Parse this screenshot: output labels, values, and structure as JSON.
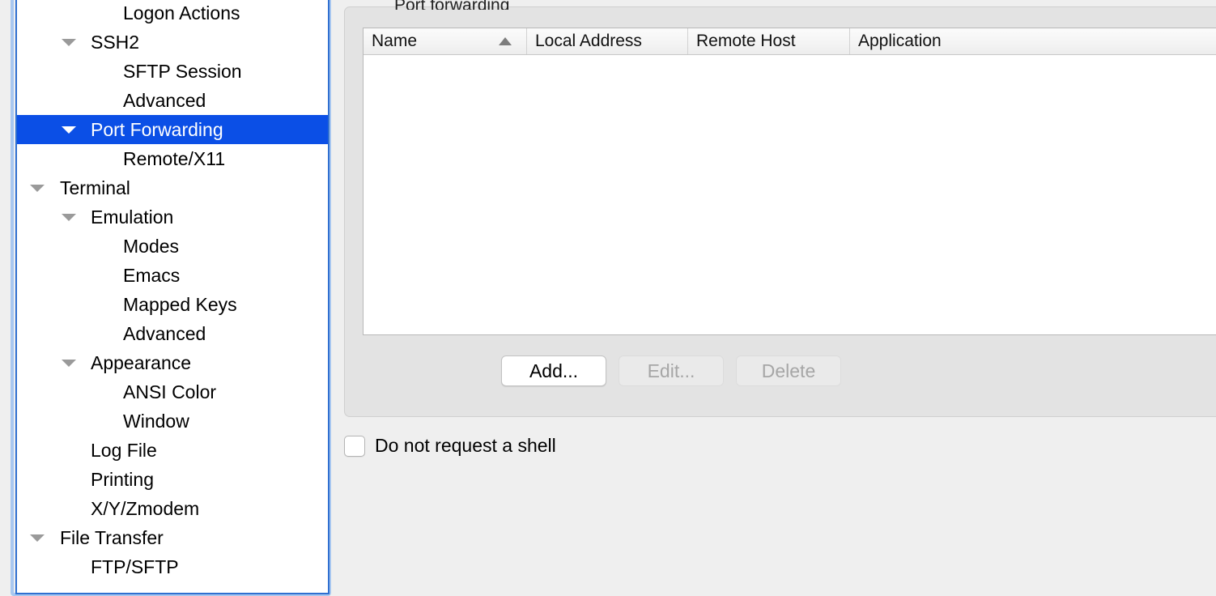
{
  "sidebar": {
    "name": "session-options-category-tree",
    "items": [
      {
        "label": "Logon Actions",
        "level": 3,
        "expandable": false,
        "selected": false
      },
      {
        "label": "SSH2",
        "level": 2,
        "expandable": true,
        "selected": false
      },
      {
        "label": "SFTP Session",
        "level": 3,
        "expandable": false,
        "selected": false
      },
      {
        "label": "Advanced",
        "level": 3,
        "expandable": false,
        "selected": false
      },
      {
        "label": "Port Forwarding",
        "level": 2,
        "expandable": true,
        "selected": true
      },
      {
        "label": "Remote/X11",
        "level": 3,
        "expandable": false,
        "selected": false
      },
      {
        "label": "Terminal",
        "level": 1,
        "expandable": true,
        "selected": false
      },
      {
        "label": "Emulation",
        "level": 2,
        "expandable": true,
        "selected": false
      },
      {
        "label": "Modes",
        "level": 3,
        "expandable": false,
        "selected": false
      },
      {
        "label": "Emacs",
        "level": 3,
        "expandable": false,
        "selected": false
      },
      {
        "label": "Mapped Keys",
        "level": 3,
        "expandable": false,
        "selected": false
      },
      {
        "label": "Advanced",
        "level": 3,
        "expandable": false,
        "selected": false
      },
      {
        "label": "Appearance",
        "level": 2,
        "expandable": true,
        "selected": false
      },
      {
        "label": "ANSI Color",
        "level": 3,
        "expandable": false,
        "selected": false
      },
      {
        "label": "Window",
        "level": 3,
        "expandable": false,
        "selected": false
      },
      {
        "label": "Log File",
        "level": 2,
        "expandable": false,
        "selected": false
      },
      {
        "label": "Printing",
        "level": 2,
        "expandable": false,
        "selected": false
      },
      {
        "label": "X/Y/Zmodem",
        "level": 2,
        "expandable": false,
        "selected": false
      },
      {
        "label": "File Transfer",
        "level": 1,
        "expandable": true,
        "selected": false
      },
      {
        "label": "FTP/SFTP",
        "level": 2,
        "expandable": false,
        "selected": false
      }
    ]
  },
  "main": {
    "group_title_fragment": "Port forwarding",
    "table": {
      "columns": [
        {
          "label": "Name",
          "sorted": "ascending"
        },
        {
          "label": "Local Address",
          "sorted": "none"
        },
        {
          "label": "Remote Host",
          "sorted": "none"
        },
        {
          "label": "Application",
          "sorted": "none"
        }
      ],
      "rows": [],
      "sort_indicator_icon": "sort-ascending-triangle-icon"
    },
    "buttons": [
      {
        "label": "Add...",
        "enabled": true
      },
      {
        "label": "Edit...",
        "enabled": false
      },
      {
        "label": "Delete",
        "enabled": false
      }
    ],
    "checkbox": {
      "label": "Do not request a shell",
      "checked": false
    }
  },
  "colors": {
    "selection_blue": "#0b4fe6",
    "focus_ring": "#a8c7f0",
    "tree_border": "#2f6fd0",
    "groupbox_bg": "#e3e3e3",
    "window_bg": "#efefef",
    "table_bg": "#ffffff",
    "disabled_text": "#a6a6a6"
  }
}
